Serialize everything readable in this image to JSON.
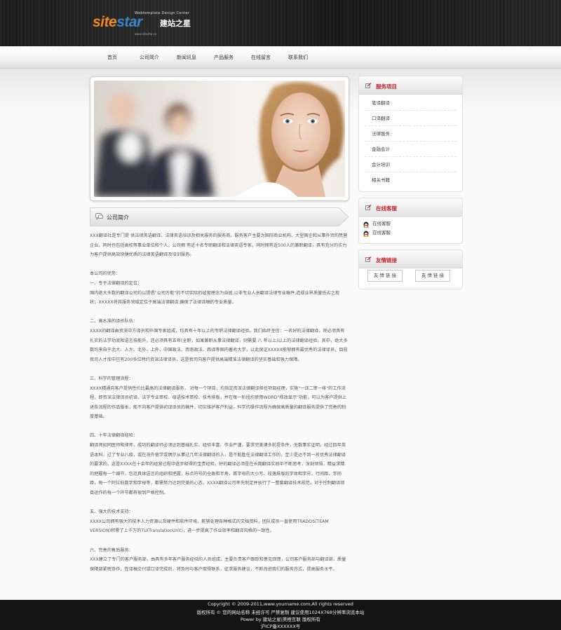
{
  "brand": {
    "tagline": "Webtemplate Design Center",
    "name_part1": "site",
    "name_part2": "star",
    "name_cn": "建站之星",
    "url": "www.sitestar.cn"
  },
  "nav": {
    "items": [
      "首页",
      "公司简介",
      "新闻讯息",
      "产品服务",
      "在线留言",
      "联系我们"
    ]
  },
  "main": {
    "section_title": "公司简介",
    "intro": "XXX翻译社是专门提 供法律英语翻译、法律英语培训及相关服务的服务商。服务客户主要为国际商业机构、大型国企和从事外贸的民营企业。同时也包括高校等事业单位和个人。公司拥 有近十名专职翻译和法律英语专家，同时拥有近500人的兼职翻译，具有充分的实力为客户提供高效快捷优质的法律英语翻译及培训服务。",
    "advantages_title": "本公司的优势：",
    "sections": [
      {
        "heading": "一、专于法律翻译的定位：",
        "body": "国内绝大多数的翻译公司均以提倡\"公司万能\"的不切实际的经营理念为自居,以非专业人员翻译法律专业稿件,造成业界质量低劣之现状；XXXXX将其服务领域定位于高端法律翻译,确保了法律译稿的专业质量。"
      },
      {
        "heading": "二、高水准的译员队伍：",
        "body": "XXXX的翻译由资深中方译员和外国专家组成，均具有十年以上的专职法律翻译经验。我们始终坚信：一名好的法律翻译，除必须具有扎实的法学功底和语言技能外，还必须具有五年(全职，如果兼职从事法律翻译，则需要 八 年以上)以上的法律翻译经验。其中，绝大多数均来自于北大、人大、北外、上外、中国政法、西南政法、西译等国内著名大学，以此保证XXXXX能够拥有最优秀的法律译员，目前我司人才库中已有200多位特约资深法律译员，这是我司向客户提供高端精准法律翻译的坚实基础和强力保障。"
      },
      {
        "heading": "三、科学的管理流程：",
        "body": "XXXX精通向客户提供性价比最高的法律翻译服务，  对每一个项目，均指定资深法律翻译担任项目经理，实施\"一译二审一排\"的工作流程，即资深法律译员初译、法学专业审校、母语技术审校、技术排版，并在每一阶段均使用WORD\"修改显示\"功能，可以为客户提供上述各流程的作品版本，能不向客户提供初译译员的稿件，切实维护客户利益，科学的操作流程为确保高质量的翻译服务提供了完善的制度基础。"
      },
      {
        "heading": "四、十年法律翻译经验：",
        "body": "翻译师如同医师和律师，成功的翻译师必须达到基础扎实、经验丰富、作业严谨，要求完美诸多前提条件，无数事实证明，经过四年英语本科，过了专业八级，或在海外留学或偶尔从事过几年法律翻译的人，是不能胜任法律翻译工作的，至少是达不到一名优秀法律翻译的要求的。这是XXXX在十余年的经营过程中逐步释得的宝贵经验，好的翻译必须是在长期翻译实践中不断思考，深刻领悟，精益求精的把握每一个细节，包括具体语言的组织和把握，标点符号的全角和半角，首字母的大小写、段落排版的字体和字号，行间距、字间距，每一个阿拉伯数字和字母等，都需努力达到完美的心态，XXXX翻译公司率先制定并执行了一整套翻译技术规范，对于控制翻译项目运作的每一个环节都有很到严格控制。"
      },
      {
        "heading": "五、强大的技术支持：",
        "body": "XXXX公司拥有强大的技术人力资源以及硬件和软件环境，能够处理各种格式的文档资料，团队成员一直使用TRADOS(TEAM VERSION)积累了上千万的TU(TranslationUnit)，进一步提高了作业效率和翻译风格的一致性。"
      },
      {
        "heading": "六、完善的售后服务：",
        "body": "XXX建立了专门的客户服务部，由具有多年客户服务经验的人员组成，主要负责客户跟踪和意见回馈，公司客户服务部与翻译部、质量保障部紧密协作，在译稿交付或口译完成后，将及时与客户取得联系，征求服务建议，不断改进我们的服务方式，提高服务水平。"
      }
    ]
  },
  "sidebar": {
    "services": {
      "title": "服务项目",
      "items": [
        "笔译翻译",
        "口译翻译",
        "法律服务",
        "金融会计",
        "会计培训",
        "相关书籍"
      ]
    },
    "support": {
      "title": "在线客服",
      "items": [
        "在线客服",
        "在线客服"
      ]
    },
    "links": {
      "title": "友情链接",
      "items": [
        "友 情 链 接",
        "友 情 链 接"
      ]
    }
  },
  "footer": {
    "lines": [
      "Copyright © 2009-2011,www.yourname.com,All rights reserved",
      "版权所有 © 您的网站名称  未经许可  严禁复制  建议使用1024X768分辨率浏览本站",
      "Power by 建站之星|美橙互联 版权所有",
      "沪ICP备XXXXXX号"
    ]
  },
  "colors": {
    "accent_red": "#c0282e",
    "header_dark": "#1c1c1c",
    "footer_dark": "#141414"
  }
}
